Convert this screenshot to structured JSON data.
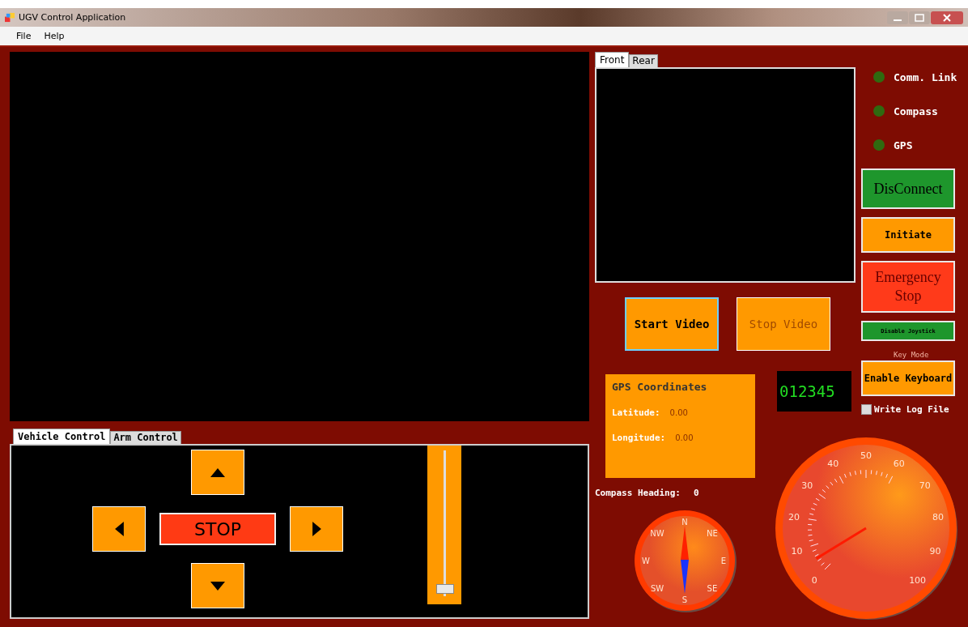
{
  "window": {
    "title": "UGV Control Application"
  },
  "menu": [
    "File",
    "Help"
  ],
  "camera_tabs": [
    {
      "label": "Front",
      "selected": true
    },
    {
      "label": "Rear",
      "selected": false
    }
  ],
  "video_buttons": [
    {
      "label": "Start Video",
      "selected": true
    },
    {
      "label": "Stop Video",
      "selected": false
    }
  ],
  "status": [
    {
      "label": "Comm. Link",
      "on": false
    },
    {
      "label": "Compass",
      "on": false
    },
    {
      "label": "GPS",
      "on": false
    }
  ],
  "actions": [
    {
      "label": "DisConnect",
      "kind": "connect"
    },
    {
      "label": "Initiate",
      "kind": "initiate"
    },
    {
      "label": "Emergency Stop",
      "kind": "estop"
    },
    {
      "label": "Disable Joystick",
      "kind": "joystick"
    }
  ],
  "mode_label": "Key Mode",
  "keyboard_button": "Enable Keyboard",
  "log_file": {
    "label": "Write Log File",
    "checked": false
  },
  "gps": {
    "title": "GPS Coordinates",
    "fields": [
      {
        "label": "Latitude:",
        "value": "0.00"
      },
      {
        "label": "Longitude:",
        "value": "0.00"
      }
    ]
  },
  "counter": "012345",
  "compass": {
    "label": "Compass Heading:",
    "value": "0",
    "points": [
      "N",
      "NE",
      "E",
      "SE",
      "S",
      "SW",
      "W",
      "NW"
    ]
  },
  "speed_gauge": {
    "labels": [
      "0",
      "10",
      "20",
      "30",
      "40",
      "50",
      "60",
      "70",
      "80",
      "90",
      "100"
    ]
  },
  "control_tabs": [
    {
      "label": "Vehicle Control",
      "selected": true
    },
    {
      "label": "Arm Control",
      "selected": false
    }
  ],
  "drive": {
    "stop": "STOP"
  },
  "throttle": {
    "level": 0.02
  }
}
